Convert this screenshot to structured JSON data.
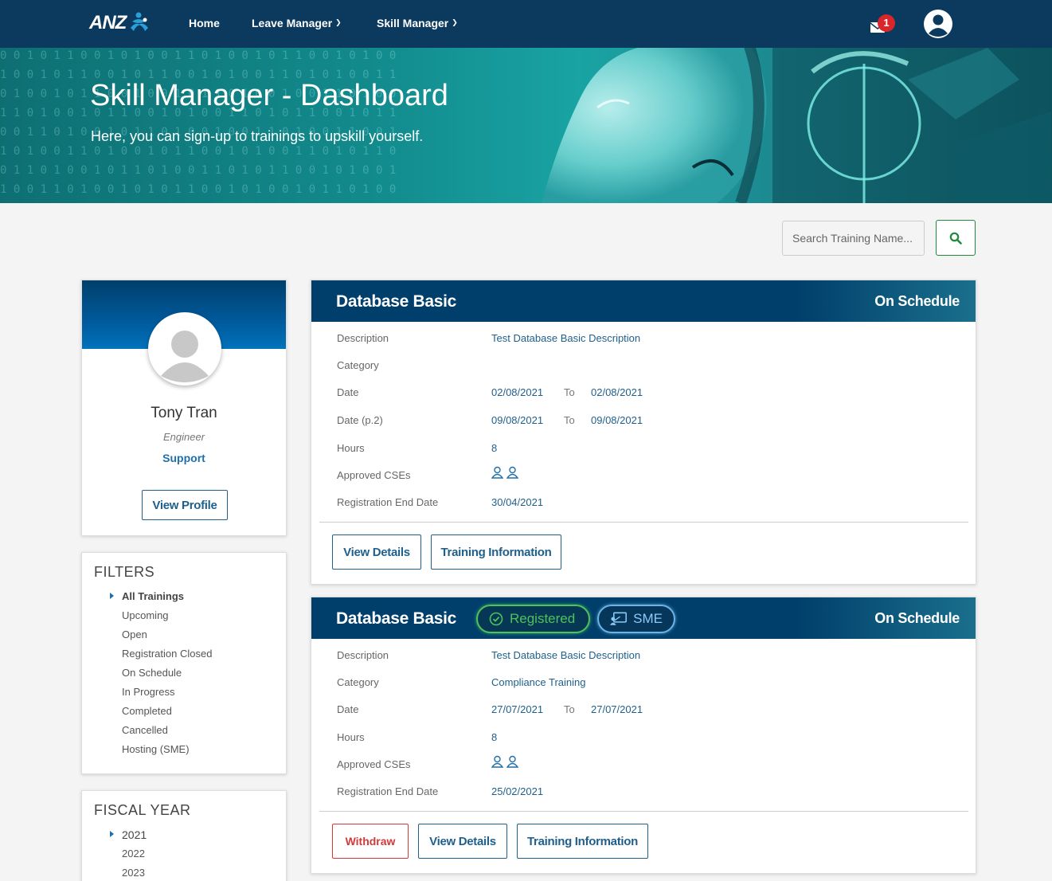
{
  "nav": {
    "logo_text": "ANZ",
    "home": "Home",
    "leave_manager": "Leave Manager",
    "skill_manager": "Skill Manager",
    "notification_count": "1"
  },
  "hero": {
    "title": "Skill Manager - Dashboard",
    "subtitle": "Here, you can sign-up to trainings to upskill yourself."
  },
  "search": {
    "placeholder": "Search Training Name..."
  },
  "profile": {
    "name": "Tony Tran",
    "role": "Engineer",
    "team": "Support",
    "button": "View Profile"
  },
  "filters": {
    "title": "FILTERS",
    "items": [
      "All Trainings",
      "Upcoming",
      "Open",
      "Registration Closed",
      "On Schedule",
      "In Progress",
      "Completed",
      "Cancelled",
      "Hosting (SME)"
    ]
  },
  "fiscal": {
    "title": "FISCAL YEAR",
    "items": [
      "2021",
      "2022",
      "2023"
    ]
  },
  "labels": {
    "description": "Description",
    "category": "Category",
    "date": "Date",
    "date_p2": "Date (p.2)",
    "hours": "Hours",
    "approved_cses": "Approved CSEs",
    "registration_end": "Registration End Date",
    "to": "To"
  },
  "trainings": [
    {
      "title": "Database Basic",
      "status": "On Schedule",
      "description": "Test Database Basic Description",
      "category": "",
      "date_from": "02/08/2021",
      "date_to": "02/08/2021",
      "date2_from": "09/08/2021",
      "date2_to": "09/08/2021",
      "hours": "8",
      "registration_end": "30/04/2021",
      "btn_details": "View Details",
      "btn_info": "Training Information"
    },
    {
      "title": "Database Basic",
      "status": "On Schedule",
      "badge_registered": "Registered",
      "badge_sme": "SME",
      "description": "Test Database Basic Description",
      "category": "Compliance Training",
      "date_from": "27/07/2021",
      "date_to": "27/07/2021",
      "hours": "8",
      "registration_end": "25/02/2021",
      "btn_withdraw": "Withdraw",
      "btn_details": "View Details",
      "btn_info": "Training Information"
    }
  ],
  "colors": {
    "navbar": "#0b3a5e",
    "primary": "#1f5f8b",
    "registered": "#4ec25b",
    "danger": "#d23a3a"
  }
}
